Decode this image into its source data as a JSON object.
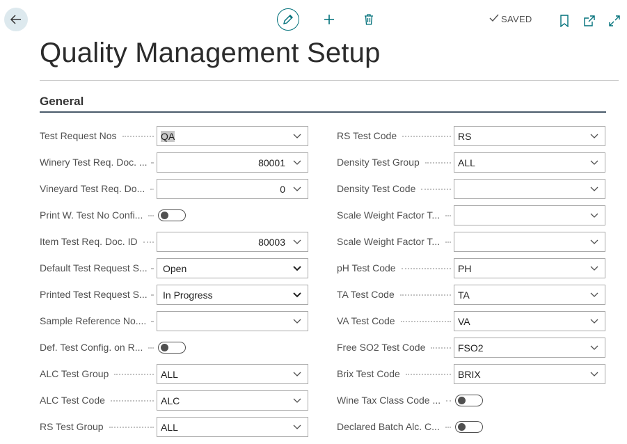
{
  "window": {
    "saved_label": "SAVED",
    "accent_color": "#00707a"
  },
  "toolbar": {
    "back_icon": "back-arrow-icon",
    "edit_icon": "pencil-icon",
    "new_icon": "plus-icon",
    "delete_icon": "trash-icon",
    "bookmark_icon": "bookmark-icon",
    "open_new_window_icon": "open-in-new-window-icon",
    "expand_icon": "expand-icon"
  },
  "page": {
    "title": "Quality Management Setup"
  },
  "section": {
    "title": "General"
  },
  "left_fields": [
    {
      "label": "Test Request Nos",
      "type": "lookup",
      "value": "QA",
      "highlight": true
    },
    {
      "label": "Winery Test Req. Doc. ...",
      "type": "lookup-num",
      "value": "80001"
    },
    {
      "label": "Vineyard Test Req. Do...",
      "type": "lookup-num",
      "value": "0"
    },
    {
      "label": "Print W. Test No Confi...",
      "type": "toggle",
      "value": "off"
    },
    {
      "label": "Item Test Req. Doc. ID",
      "type": "lookup-num",
      "value": "80003"
    },
    {
      "label": "Default Test Request S...",
      "type": "select",
      "value": "Open"
    },
    {
      "label": "Printed Test Request S...",
      "type": "select",
      "value": "In Progress"
    },
    {
      "label": "Sample Reference No....",
      "type": "lookup",
      "value": ""
    },
    {
      "label": "Def. Test Config. on R...",
      "type": "toggle",
      "value": "off"
    },
    {
      "label": "ALC Test Group",
      "type": "lookup",
      "value": "ALL"
    },
    {
      "label": "ALC Test Code",
      "type": "lookup",
      "value": "ALC"
    },
    {
      "label": "RS Test Group",
      "type": "lookup",
      "value": "ALL"
    }
  ],
  "right_fields": [
    {
      "label": "RS Test Code",
      "type": "lookup",
      "value": "RS"
    },
    {
      "label": "Density Test Group",
      "type": "lookup",
      "value": "ALL"
    },
    {
      "label": "Density Test Code",
      "type": "lookup",
      "value": ""
    },
    {
      "label": "Scale Weight Factor T...",
      "type": "lookup",
      "value": ""
    },
    {
      "label": "Scale Weight Factor T...",
      "type": "lookup",
      "value": ""
    },
    {
      "label": "pH Test Code",
      "type": "lookup",
      "value": "PH"
    },
    {
      "label": "TA Test Code",
      "type": "lookup",
      "value": "TA"
    },
    {
      "label": "VA Test Code",
      "type": "lookup",
      "value": "VA"
    },
    {
      "label": "Free SO2 Test Code",
      "type": "lookup",
      "value": "FSO2"
    },
    {
      "label": "Brix Test Code",
      "type": "lookup",
      "value": "BRIX"
    },
    {
      "label": "Wine Tax Class Code ...",
      "type": "toggle",
      "value": "off"
    },
    {
      "label": "Declared Batch Alc. C...",
      "type": "toggle",
      "value": "off"
    }
  ]
}
